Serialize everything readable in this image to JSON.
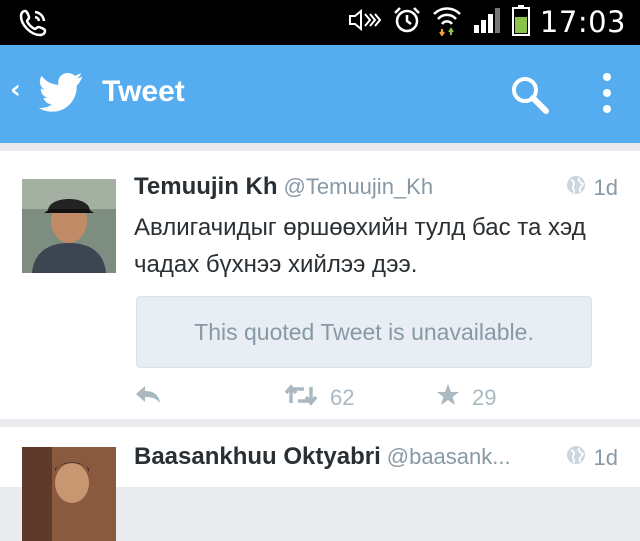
{
  "status_bar": {
    "time": "17:03"
  },
  "app_bar": {
    "title": "Tweet"
  },
  "tweets": [
    {
      "name": "Temuujin Kh",
      "handle": "@Temuujin_Kh",
      "time": "1d",
      "text": "Авлигачидыг өршөөхийн тулд бас та хэд чадах бүхнээ хийлээ дээ.",
      "quote": "This quoted Tweet is unavailable.",
      "retweets": "62",
      "favorites": "29"
    },
    {
      "name": "Baasankhuu Oktyabri",
      "handle": "@baasank...",
      "time": "1d"
    }
  ],
  "colors": {
    "app_bar": "#55acee",
    "status_bar": "#000000",
    "battery_green": "#8bc34a",
    "feed_bg": "#e9ebee",
    "quote_bg": "#e8eef3",
    "muted_text": "#8899a6",
    "action_icons": "#aab8c2"
  },
  "icons": [
    "phone-icon",
    "mute-icon",
    "alarm-icon",
    "wifi-icon",
    "signal-icon",
    "battery-icon",
    "back-icon",
    "twitter-bird-icon",
    "search-icon",
    "overflow-menu-icon",
    "globe-icon",
    "reply-icon",
    "retweet-icon",
    "star-icon"
  ]
}
